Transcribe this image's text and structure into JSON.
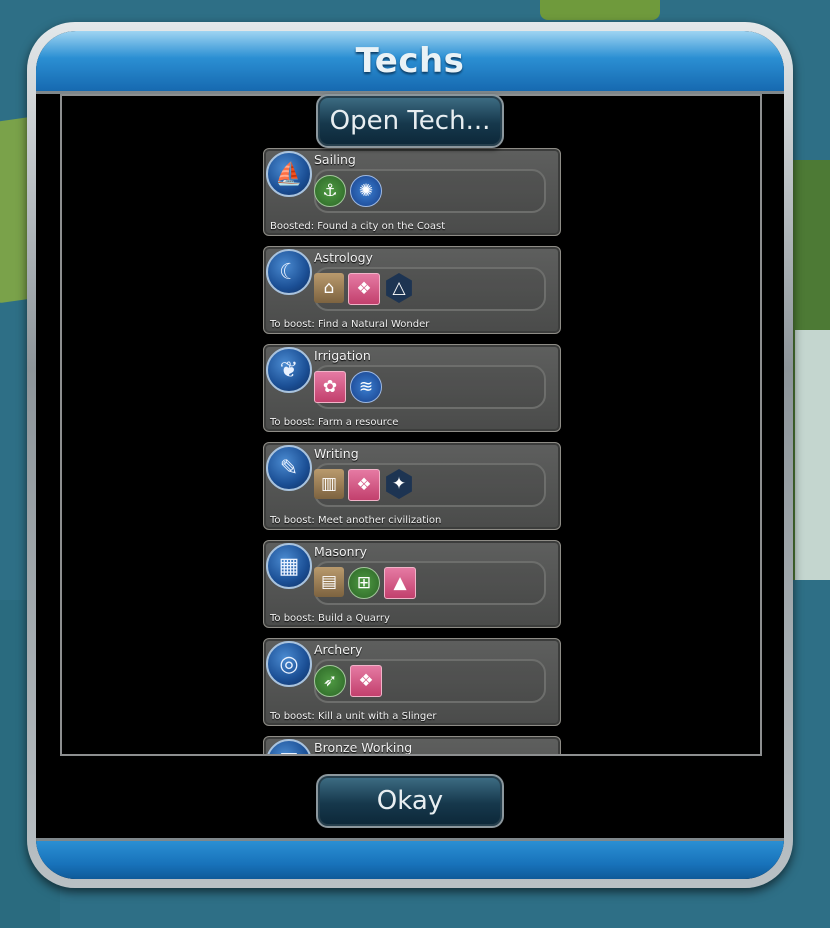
{
  "dialog": {
    "title": "Techs",
    "open_button_label": "Open Tech...",
    "okay_button_label": "Okay"
  },
  "techs": [
    {
      "name": "Sailing",
      "icon": "sailboat-icon",
      "boost": "Boosted: Found a city on the Coast",
      "unlocks": [
        {
          "icon": "harbor-district-icon",
          "style": "green"
        },
        {
          "icon": "fishing-boats-icon",
          "style": "blue"
        }
      ]
    },
    {
      "name": "Astrology",
      "icon": "moon-stars-icon",
      "boost": "To boost: Find a Natural Wonder",
      "unlocks": [
        {
          "icon": "temple-building-icon",
          "style": "bldg"
        },
        {
          "icon": "wonder-icon",
          "style": "pink"
        },
        {
          "icon": "holy-site-district-icon",
          "style": "dark"
        }
      ]
    },
    {
      "name": "Irrigation",
      "icon": "water-sprout-icon",
      "boost": "To boost: Farm a resource",
      "unlocks": [
        {
          "icon": "hanging-gardens-icon",
          "style": "pink"
        },
        {
          "icon": "farm-improvement-icon",
          "style": "blue"
        }
      ]
    },
    {
      "name": "Writing",
      "icon": "quill-icon",
      "boost": "To boost: Meet another civilization",
      "unlocks": [
        {
          "icon": "library-building-icon",
          "style": "bldg"
        },
        {
          "icon": "wonder-icon",
          "style": "pink"
        },
        {
          "icon": "campus-district-icon",
          "style": "dark"
        }
      ]
    },
    {
      "name": "Masonry",
      "icon": "wall-trowel-icon",
      "boost": "To boost: Build a Quarry",
      "unlocks": [
        {
          "icon": "walls-building-icon",
          "style": "bldg"
        },
        {
          "icon": "battering-ram-icon",
          "style": "green"
        },
        {
          "icon": "pyramids-wonder-icon",
          "style": "pink"
        }
      ]
    },
    {
      "name": "Archery",
      "icon": "target-icon",
      "boost": "To boost: Kill a unit with a Slinger",
      "unlocks": [
        {
          "icon": "archer-unit-icon",
          "style": "green"
        },
        {
          "icon": "wonder-icon",
          "style": "pink"
        }
      ]
    },
    {
      "name": "Bronze Working",
      "icon": "shield-icon",
      "boost": "",
      "unlocks": []
    }
  ]
}
